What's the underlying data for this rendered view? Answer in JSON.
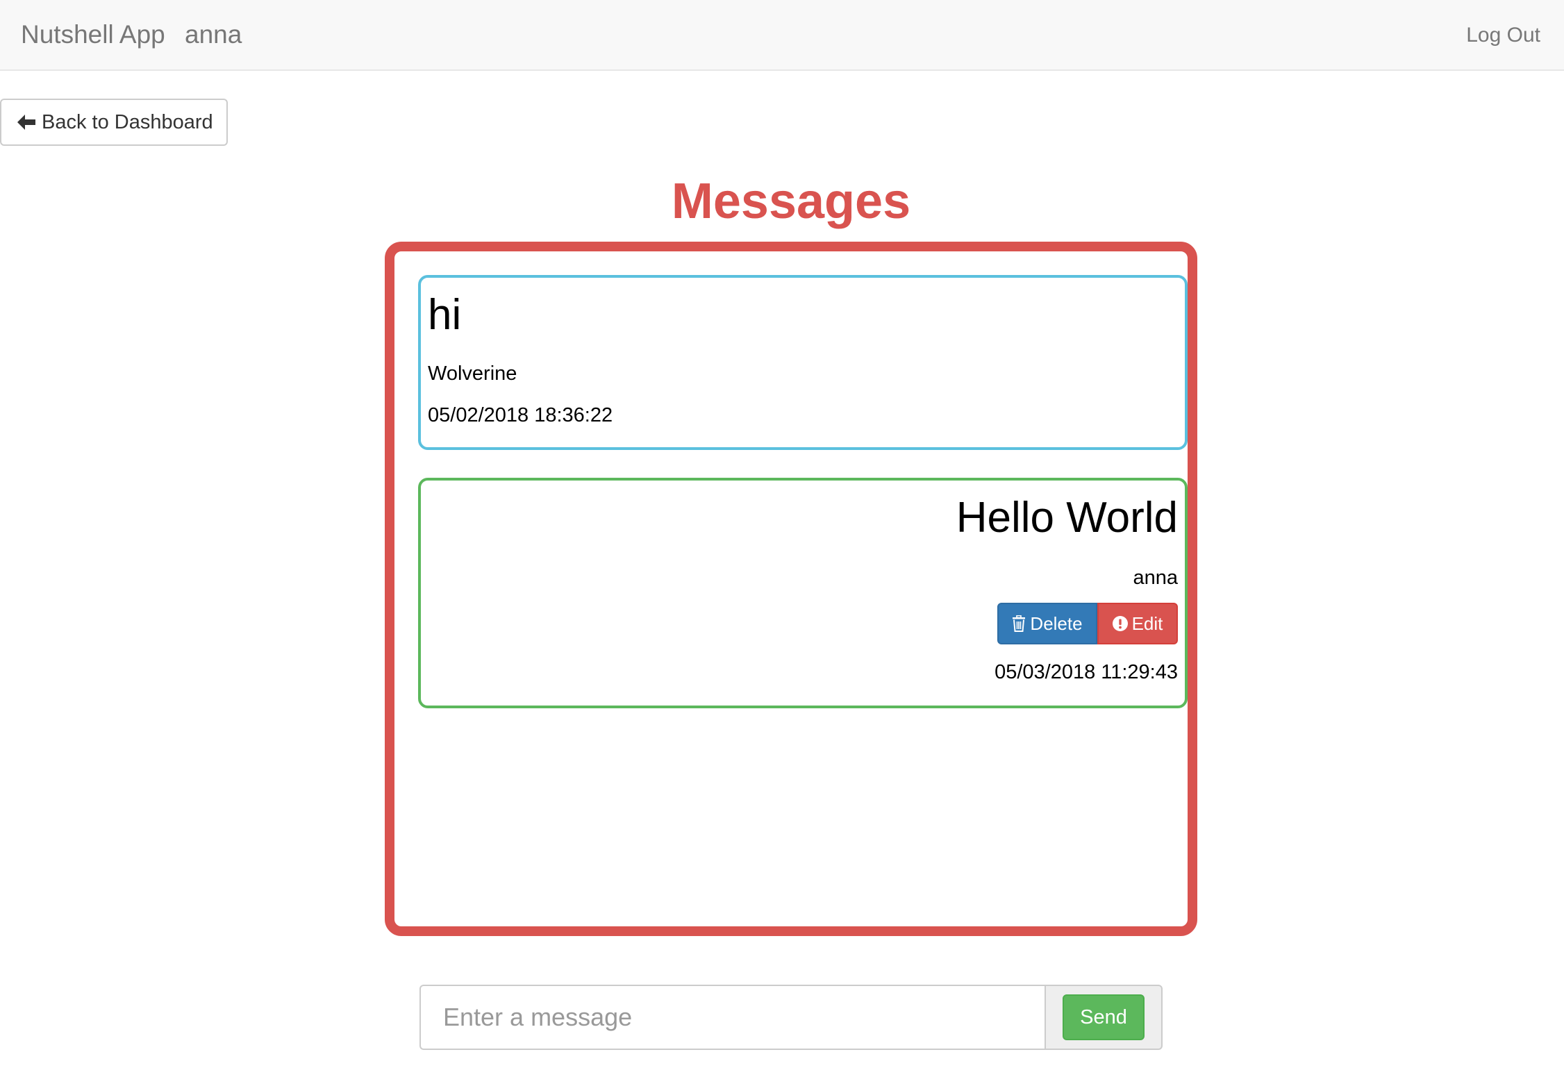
{
  "navbar": {
    "brand": "Nutshell App",
    "username": "anna",
    "logout_label": "Log Out"
  },
  "back_button": {
    "label": "Back to Dashboard",
    "icon": "arrow-left-icon"
  },
  "page_title": "Messages",
  "messages": [
    {
      "text": "hi",
      "author": "Wolverine",
      "timestamp": "05/02/2018 18:36:22",
      "own": false,
      "border_color": "#5bc0de"
    },
    {
      "text": "Hello World",
      "author": "anna",
      "timestamp": "05/03/2018 11:29:43",
      "own": true,
      "border_color": "#5cb85c",
      "actions": {
        "delete_label": "Delete",
        "delete_icon": "trash-icon",
        "edit_label": "Edit",
        "edit_icon": "exclamation-circle-icon"
      }
    }
  ],
  "composer": {
    "placeholder": "Enter a message",
    "value": "",
    "send_label": "Send"
  },
  "colors": {
    "accent_red": "#d9534f",
    "info_blue": "#5bc0de",
    "success_green": "#5cb85c",
    "primary_blue": "#337ab7"
  }
}
